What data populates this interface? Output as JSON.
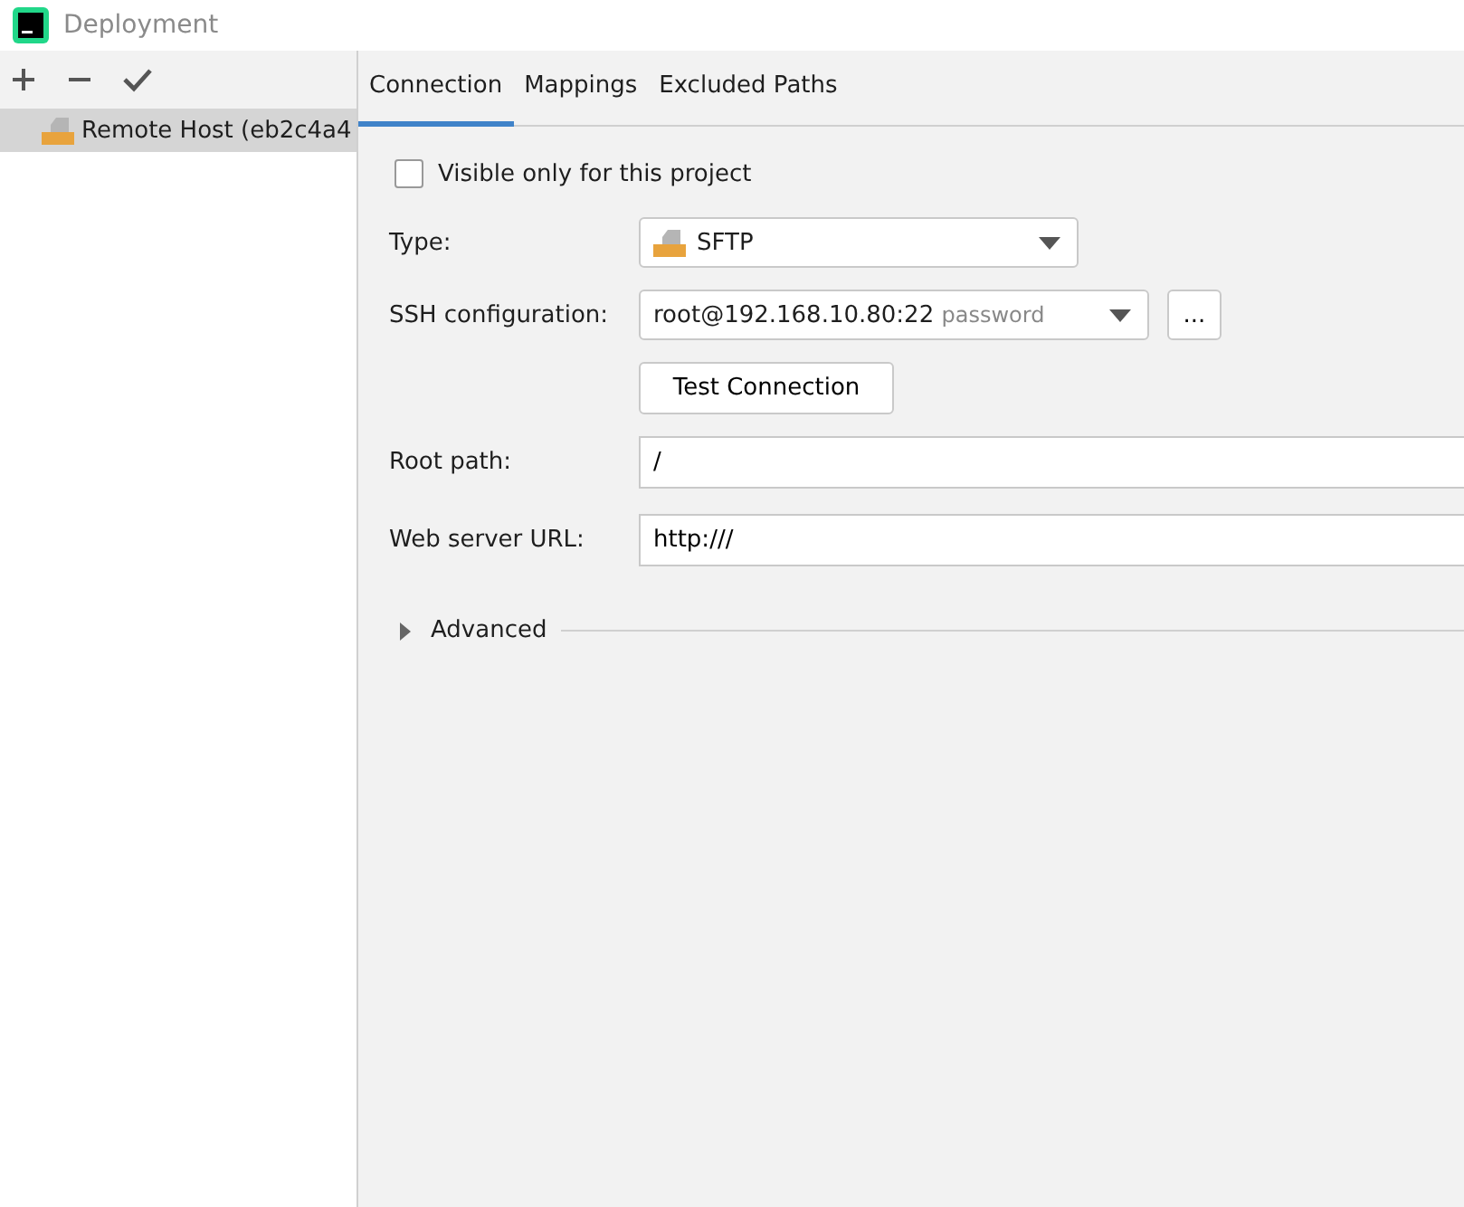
{
  "window": {
    "title": "Deployment"
  },
  "toolbar": {
    "buttons": [
      {
        "kind": "add"
      },
      {
        "kind": "remove"
      },
      {
        "kind": "apply"
      }
    ]
  },
  "servers": [
    {
      "label": "Remote Host (eb2c4a4",
      "selected": true
    }
  ],
  "tabs": [
    {
      "label": "Connection",
      "selected": true
    },
    {
      "label": "Mappings",
      "selected": false
    },
    {
      "label": "Excluded Paths",
      "selected": false
    }
  ],
  "visible_only": {
    "label": "Visible only for this project",
    "checked": false
  },
  "type": {
    "label": "Type:",
    "value": "SFTP"
  },
  "ssh": {
    "label": "SSH configuration:",
    "value": "root@192.168.10.80:22",
    "hint": "password",
    "more": "..."
  },
  "test_button": "Test Connection",
  "root_path": {
    "label": "Root path:",
    "value": "/"
  },
  "web_url": {
    "label": "Web server URL:",
    "value": "http:///"
  },
  "advanced": {
    "label": "Advanced",
    "expanded": false
  }
}
